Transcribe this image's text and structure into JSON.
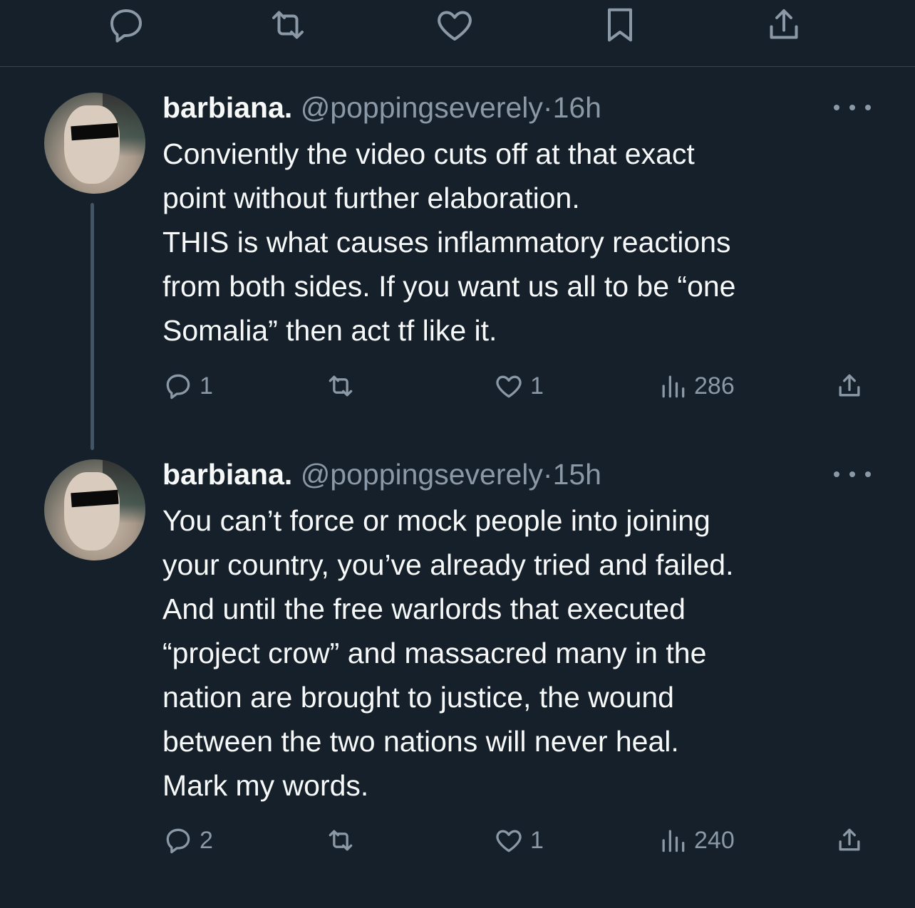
{
  "top_bar": {
    "icons": [
      "reply-icon",
      "retweet-icon",
      "like-icon",
      "bookmark-icon",
      "share-icon"
    ]
  },
  "colors": {
    "background": "#15202b",
    "text": "#f7f9f9",
    "muted": "#8b98a5",
    "divider": "#38444d"
  },
  "tweets": [
    {
      "name": "barbiana.",
      "handle": "@poppingseverely",
      "separator": "·",
      "time": "16h",
      "lines": [
        "Conviently the video cuts off at that exact",
        "point without further elaboration.",
        "THIS is what causes inflammatory reactions",
        "from both sides. If you want us all to be “one",
        "Somalia” then act tf like it."
      ],
      "replies": "1",
      "retweets": "",
      "likes": "1",
      "views": "286"
    },
    {
      "name": "barbiana.",
      "handle": "@poppingseverely",
      "separator": "·",
      "time": "15h",
      "lines": [
        "You can’t force or mock people into joining",
        "your country, you’ve already tried and failed.",
        "And until the free warlords that executed",
        "“project crow” and massacred many in the",
        "nation are brought to justice, the wound",
        "between the two nations will never heal.",
        "Mark my words."
      ],
      "replies": "2",
      "retweets": "",
      "likes": "1",
      "views": "240"
    }
  ]
}
